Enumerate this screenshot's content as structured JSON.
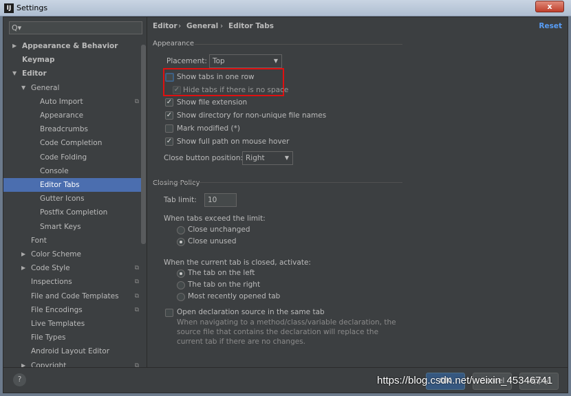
{
  "window": {
    "title": "Settings",
    "close": "x"
  },
  "search": {
    "icon": "Q▾"
  },
  "tree": [
    {
      "label": "Appearance & Behavior",
      "level": 0,
      "arrow": "▶",
      "bold": true
    },
    {
      "label": "Keymap",
      "level": 0,
      "bold": true
    },
    {
      "label": "Editor",
      "level": 0,
      "arrow": "▼",
      "bold": true
    },
    {
      "label": "General",
      "level": 1,
      "arrow": "▼"
    },
    {
      "label": "Auto Import",
      "level": 2,
      "copy": true
    },
    {
      "label": "Appearance",
      "level": 2
    },
    {
      "label": "Breadcrumbs",
      "level": 2
    },
    {
      "label": "Code Completion",
      "level": 2
    },
    {
      "label": "Code Folding",
      "level": 2
    },
    {
      "label": "Console",
      "level": 2
    },
    {
      "label": "Editor Tabs",
      "level": 2,
      "selected": true
    },
    {
      "label": "Gutter Icons",
      "level": 2
    },
    {
      "label": "Postfix Completion",
      "level": 2
    },
    {
      "label": "Smart Keys",
      "level": 2
    },
    {
      "label": "Font",
      "level": 1
    },
    {
      "label": "Color Scheme",
      "level": 1,
      "arrow": "▶"
    },
    {
      "label": "Code Style",
      "level": 1,
      "arrow": "▶",
      "copy": true
    },
    {
      "label": "Inspections",
      "level": 1,
      "copy": true
    },
    {
      "label": "File and Code Templates",
      "level": 1,
      "copy": true
    },
    {
      "label": "File Encodings",
      "level": 1,
      "copy": true
    },
    {
      "label": "Live Templates",
      "level": 1
    },
    {
      "label": "File Types",
      "level": 1
    },
    {
      "label": "Android Layout Editor",
      "level": 1
    },
    {
      "label": "Copyright",
      "level": 1,
      "arrow": "▶",
      "copy": true
    }
  ],
  "breadcrumb": [
    "Editor",
    "General",
    "Editor Tabs"
  ],
  "breadcrumb_sep": "›",
  "reset": "Reset",
  "appearance": {
    "title": "Appearance",
    "placement_label": "Placement:",
    "placement_value": "Top",
    "show_one_row": {
      "label": "Show tabs in one row",
      "checked": false
    },
    "hide_no_space": {
      "label": "Hide tabs if there is no space",
      "checked": true,
      "check": "✓"
    },
    "show_ext": {
      "label": "Show file extension",
      "checked": true,
      "check": "✓"
    },
    "show_dir": {
      "label": "Show directory for non-unique file names",
      "checked": true,
      "check": "✓"
    },
    "mark_mod": {
      "label": "Mark modified (*)",
      "checked": false
    },
    "full_path": {
      "label": "Show full path on mouse hover",
      "checked": true,
      "check": "✓"
    },
    "close_pos_label": "Close button position:",
    "close_pos_value": "Right"
  },
  "closing": {
    "title": "Closing Policy",
    "tab_limit_label": "Tab limit:",
    "tab_limit": "10",
    "exceed_label": "When tabs exceed the limit:",
    "exceed_options": [
      {
        "label": "Close unchanged",
        "selected": false
      },
      {
        "label": "Close unused",
        "selected": true
      }
    ],
    "activate_label": "When the current tab is closed, activate:",
    "activate_options": [
      {
        "label": "The tab on the left",
        "selected": true
      },
      {
        "label": "The tab on the right",
        "selected": false
      },
      {
        "label": "Most recently opened tab",
        "selected": false
      }
    ],
    "open_decl": {
      "label": "Open declaration source in the same tab",
      "checked": false
    },
    "note": "When navigating to a method/class/variable declaration, the source file that contains the declaration will replace the current tab if there are no changes."
  },
  "footer": {
    "help": "?",
    "ok": "OK",
    "cancel": "Cancel",
    "apply": "Apply"
  },
  "watermark": "https://blog.csdn.net/weixin_45346741",
  "colors": {
    "selection": "#4b6eaf",
    "highlight_box": "#e01010",
    "link": "#589df6"
  }
}
